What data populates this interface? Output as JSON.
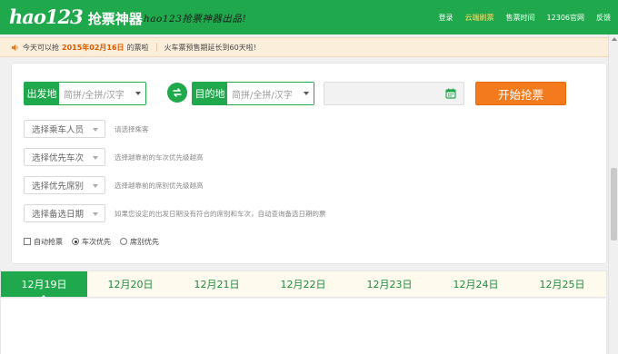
{
  "header": {
    "logo_mark": "hao123",
    "logo_title": "抢票神器",
    "slogan": "hao123抢票神器出品!",
    "nav": [
      {
        "label": "登录",
        "active": false
      },
      {
        "label": "云端刷票",
        "active": true
      },
      {
        "label": "售票时间",
        "active": false
      },
      {
        "label": "12306官网",
        "active": false
      },
      {
        "label": "反馈",
        "active": false
      }
    ]
  },
  "notice": {
    "prefix": "今天可以抢",
    "date": "2015年02月16日",
    "suffix": "的票啦",
    "extra": "火车票预售期延长到60天啦!"
  },
  "search": {
    "from_label": "出发地",
    "from_placeholder": "简拼/全拼/汉字",
    "to_label": "目的地",
    "to_placeholder": "简拼/全拼/汉字",
    "date_value": "",
    "start_button": "开始抢票"
  },
  "options": [
    {
      "select": "选择乘车人员",
      "hint": "请选择乘客"
    },
    {
      "select": "选择优先车次",
      "hint": "选择越靠前的车次优先级越高"
    },
    {
      "select": "选择优先席别",
      "hint": "选择越靠前的席别优先级越高"
    },
    {
      "select": "选择备选日期",
      "hint": "如果您设定的出发日期没有符合的席别和车次，自动查询备选日期的票"
    }
  ],
  "checks": {
    "auto_label": "自动抢票",
    "auto_checked": false,
    "train_first_label": "车次优先",
    "train_first_selected": true,
    "seat_first_label": "席别优先",
    "seat_first_selected": false
  },
  "date_tabs": [
    {
      "label": "12月19日",
      "active": true
    },
    {
      "label": "12月20日",
      "active": false
    },
    {
      "label": "12月21日",
      "active": false
    },
    {
      "label": "12月22日",
      "active": false
    },
    {
      "label": "12月23日",
      "active": false
    },
    {
      "label": "12月24日",
      "active": false
    },
    {
      "label": "12月25日",
      "active": false
    }
  ],
  "colors": {
    "brand_green": "#1fa84c",
    "action_orange": "#f37b1d",
    "notice_bg": "#fbeedb",
    "highlight_date": "#d85a00"
  }
}
